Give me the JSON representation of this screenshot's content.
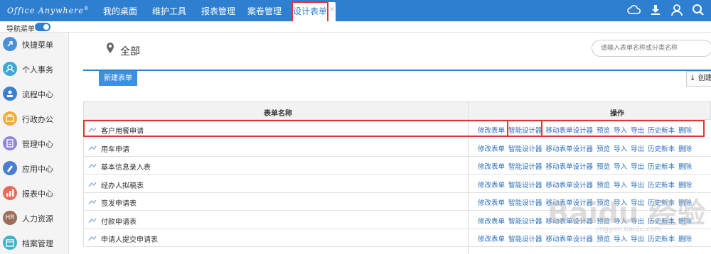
{
  "app": {
    "logo": "Office Anywhere",
    "logo_mark": "®"
  },
  "nav_tabs": [
    {
      "label": "我的桌面"
    },
    {
      "label": "维护工具"
    },
    {
      "label": "报表管理"
    },
    {
      "label": "案卷管理"
    },
    {
      "label": "设计表单",
      "active": true,
      "close": "×"
    }
  ],
  "top_icons": [
    "cloud-icon",
    "download-icon",
    "user-icon",
    "search-icon"
  ],
  "subbar": {
    "nav_menu_label": "导航菜单",
    "toggle_on": true
  },
  "sidebar": {
    "items": [
      {
        "label": "快捷菜单",
        "icon": "shortcut-icon",
        "color": "#4a90d9"
      },
      {
        "label": "个人事务",
        "icon": "person-icon",
        "color": "#3aa9d6"
      },
      {
        "label": "流程中心",
        "icon": "flow-icon",
        "color": "#3b7fd4"
      },
      {
        "label": "行政办公",
        "icon": "office-icon",
        "color": "#f0ad3c"
      },
      {
        "label": "管理中心",
        "icon": "manage-icon",
        "color": "#8f86d9"
      },
      {
        "label": "应用中心",
        "icon": "app-icon",
        "color": "#4a7fd0"
      },
      {
        "label": "报表中心",
        "icon": "report-icon",
        "color": "#e86b5c"
      },
      {
        "label": "人力资源",
        "icon": "hr-icon",
        "color": "#9b6e5a",
        "text": "HR"
      },
      {
        "label": "档案管理",
        "icon": "archive-icon",
        "color": "#3db3c9"
      }
    ]
  },
  "main": {
    "crumb": "全部",
    "search_placeholder": "请输入表单名称或分类名称",
    "new_button": "新建表单",
    "create_button": "创建",
    "table": {
      "col_name": "表单名称",
      "col_ops": "操作",
      "ops": [
        "修改表单",
        "智能设计器",
        "移动表单设计器",
        "预览",
        "导入",
        "导出",
        "历史新本",
        "删除"
      ],
      "rows": [
        "客户用餐申请",
        "用车申请",
        "基本信息录入表",
        "经办人拟稿表",
        "签发申请表",
        "付款申请表",
        "申请人提交申请表"
      ]
    }
  },
  "watermark": {
    "main": "Baidu 经验",
    "sub": "jingyan.baidu.com"
  }
}
